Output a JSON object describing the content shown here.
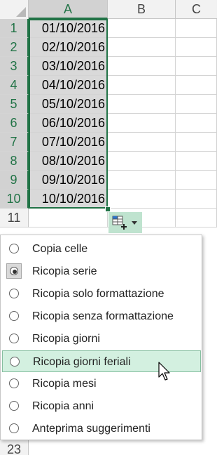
{
  "columns": [
    "A",
    "B",
    "C"
  ],
  "rows": [
    {
      "num": "1",
      "value": "01/10/2016"
    },
    {
      "num": "2",
      "value": "02/10/2016"
    },
    {
      "num": "3",
      "value": "03/10/2016"
    },
    {
      "num": "4",
      "value": "04/10/2016"
    },
    {
      "num": "5",
      "value": "05/10/2016"
    },
    {
      "num": "6",
      "value": "06/10/2016"
    },
    {
      "num": "7",
      "value": "07/10/2016"
    },
    {
      "num": "8",
      "value": "08/10/2016"
    },
    {
      "num": "9",
      "value": "09/10/2016"
    },
    {
      "num": "10",
      "value": "10/10/2016"
    },
    {
      "num": "11",
      "value": ""
    }
  ],
  "bottom_row_num": "23",
  "menu": {
    "items": [
      {
        "label": "Copia celle",
        "checked": false,
        "hover": false
      },
      {
        "label": "Ricopia serie",
        "checked": true,
        "hover": false
      },
      {
        "label": "Ricopia solo formattazione",
        "checked": false,
        "hover": false
      },
      {
        "label": "Ricopia senza formattazione",
        "checked": false,
        "hover": false
      },
      {
        "label": "Ricopia giorni",
        "checked": false,
        "hover": false
      },
      {
        "label": "Ricopia giorni feriali",
        "checked": false,
        "hover": true
      },
      {
        "label": "Ricopia mesi",
        "checked": false,
        "hover": false
      },
      {
        "label": "Ricopia anni",
        "checked": false,
        "hover": false
      },
      {
        "label": "Anteprima suggerimenti",
        "checked": false,
        "hover": false
      }
    ]
  },
  "colors": {
    "accent": "#217346",
    "hover_bg": "#d3f0e0",
    "autofill_bg": "#bfe3cf"
  }
}
